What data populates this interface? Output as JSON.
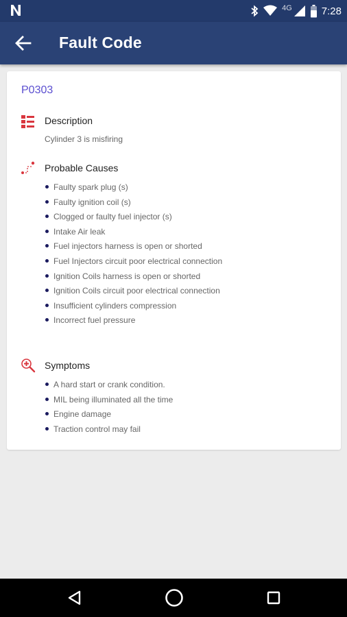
{
  "status_bar": {
    "network_label": "4G",
    "time": "7:28",
    "icons": [
      "n-notification-icon",
      "bluetooth-icon",
      "wifi-icon",
      "signal-icon",
      "battery-icon"
    ]
  },
  "app_bar": {
    "title": "Fault Code",
    "back_icon": "arrow-left-icon"
  },
  "fault": {
    "code": "P0303",
    "description": {
      "title": "Description",
      "icon": "list-icon",
      "text": "Cylinder 3 is misfiring"
    },
    "causes": {
      "title": "Probable Causes",
      "icon": "route-icon",
      "items": [
        "Faulty spark plug (s)",
        "Faulty ignition coil (s)",
        "Clogged or faulty fuel injector (s)",
        "Intake Air leak",
        "Fuel injectors harness is open or shorted",
        "Fuel Injectors circuit poor electrical connection",
        "Ignition Coils harness is open or shorted",
        "Ignition Coils circuit poor electrical connection",
        "Insufficient cylinders compression",
        "Incorrect fuel pressure"
      ]
    },
    "symptoms": {
      "title": "Symptoms",
      "icon": "medical-search-icon",
      "items": [
        "A hard start or crank condition.",
        "MIL being illuminated all the time",
        "Engine damage",
        "Traction control may fail"
      ]
    }
  },
  "colors": {
    "app_bar": "#2a4275",
    "status_bar": "#233a6b",
    "code_text": "#5b4fd0",
    "icon_red": "#d9363e",
    "bullet": "#1a1a5e",
    "background": "#ececec"
  },
  "nav_bar": {
    "buttons": [
      "back-triangle-icon",
      "home-circle-icon",
      "recents-square-icon"
    ]
  }
}
